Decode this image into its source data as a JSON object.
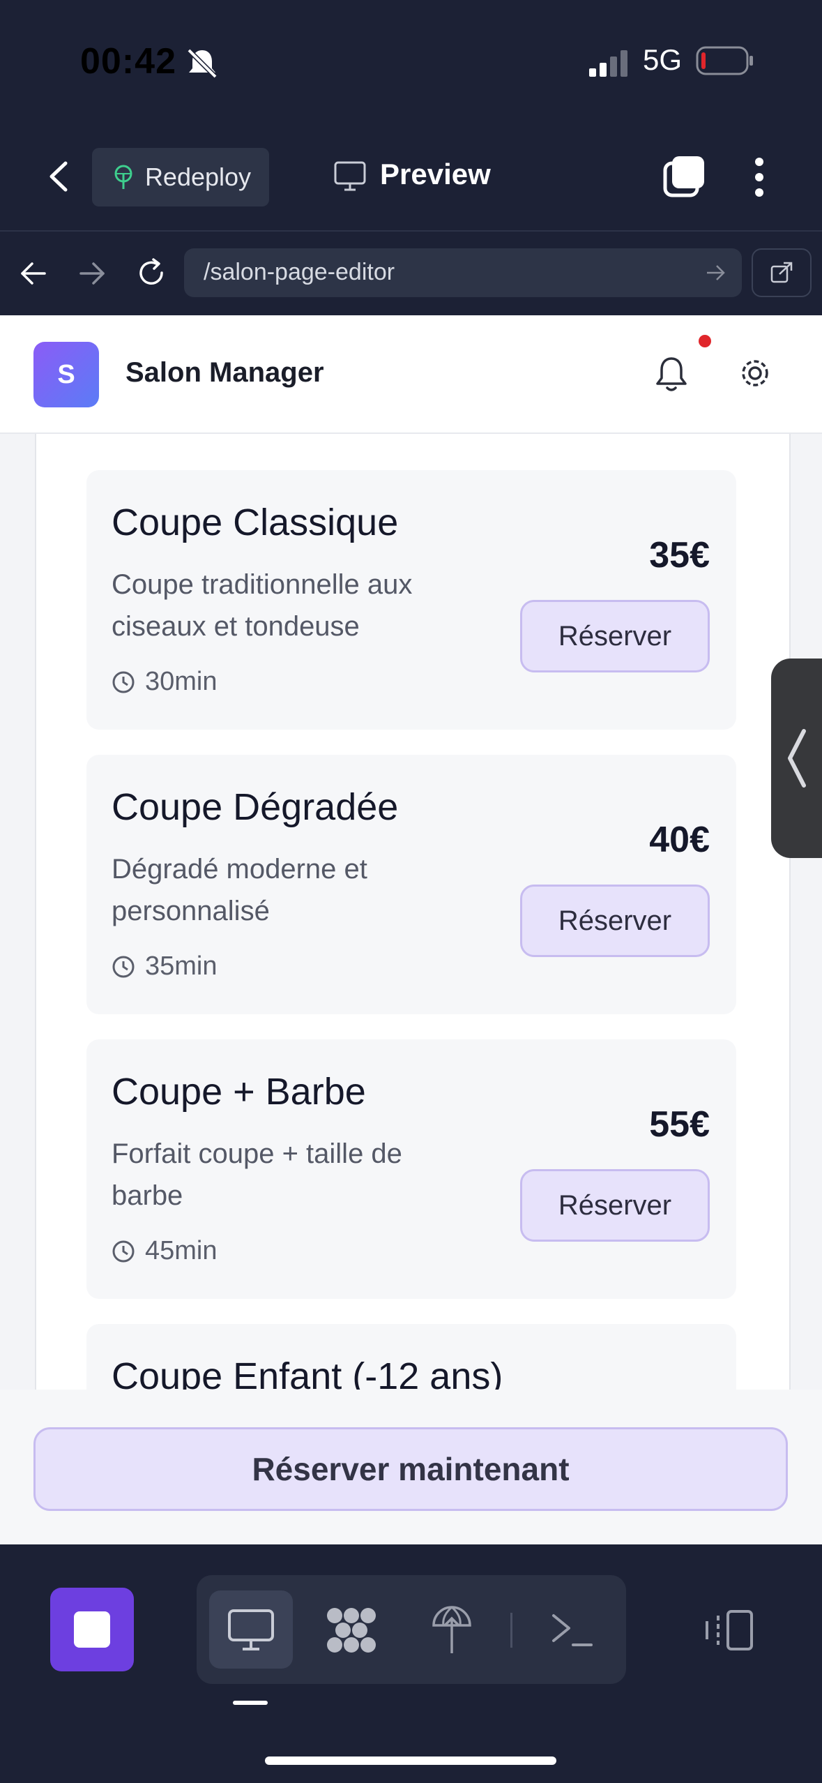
{
  "status_bar": {
    "time": "00:42",
    "network": "5G"
  },
  "nav": {
    "redeploy_label": "Redeploy",
    "preview_label": "Preview"
  },
  "browser": {
    "url": "/salon-page-editor"
  },
  "app": {
    "logo_letter": "S",
    "title": "Salon Manager"
  },
  "services": [
    {
      "title": "Coupe Classique",
      "description": "Coupe traditionnelle aux ciseaux et tondeuse",
      "duration": "30min",
      "price": "35€",
      "button": "Réserver"
    },
    {
      "title": "Coupe Dégradée",
      "description": "Dégradé moderne et personnalisé",
      "duration": "35min",
      "price": "40€",
      "button": "Réserver"
    },
    {
      "title": "Coupe + Barbe",
      "description": "Forfait coupe + taille de barbe",
      "duration": "45min",
      "price": "55€",
      "button": "Réserver"
    },
    {
      "title": "Coupe Enfant (-12 ans)"
    }
  ],
  "cta": {
    "label": "Réserver maintenant"
  },
  "colors": {
    "accent": "#6d3fe0",
    "button_bg": "#e7e2fb",
    "dark_bg": "#1c2135",
    "notification_dot": "#e0262b"
  }
}
